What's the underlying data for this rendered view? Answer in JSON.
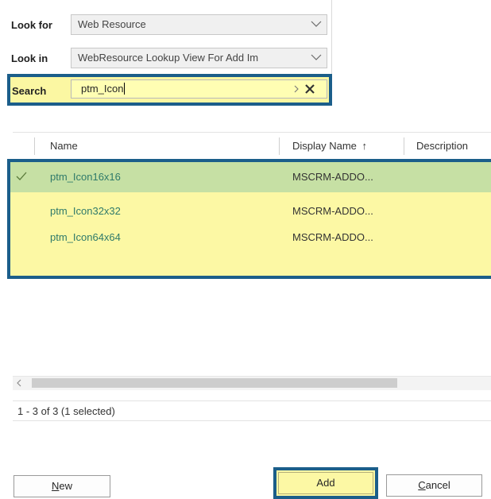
{
  "form": {
    "look_for_label": "Look for",
    "look_for_value": "Web Resource",
    "look_in_label": "Look in",
    "look_in_value": "WebResource Lookup View For Add Im",
    "search_label": "Search",
    "search_value": "ptm_Icon"
  },
  "grid": {
    "columns": [
      "Name",
      "Display Name",
      "Description"
    ],
    "sort_indicator": "↑",
    "rows": [
      {
        "name": "ptm_Icon16x16",
        "display_name": "MSCRM-ADDO...",
        "selected": true
      },
      {
        "name": "ptm_Icon32x32",
        "display_name": "MSCRM-ADDO...",
        "selected": false
      },
      {
        "name": "ptm_Icon64x64",
        "display_name": "MSCRM-ADDO...",
        "selected": false
      }
    ],
    "status": "1 - 3 of 3 (1 selected)"
  },
  "buttons": {
    "new_mnemonic": "N",
    "new_rest": "ew",
    "add": "Add",
    "cancel_mnemonic": "C",
    "cancel_rest": "ancel"
  },
  "colors": {
    "highlight_yellow": "#fcf8a4",
    "highlight_border": "#1b5e8a",
    "selected_row": "#c6e0a4",
    "link_text": "#2f7a6a"
  },
  "icons": [
    "chevron-down-icon",
    "chevron-right-icon",
    "clear-icon",
    "checkmark-icon",
    "sort-asc-icon",
    "scroll-left-icon"
  ]
}
